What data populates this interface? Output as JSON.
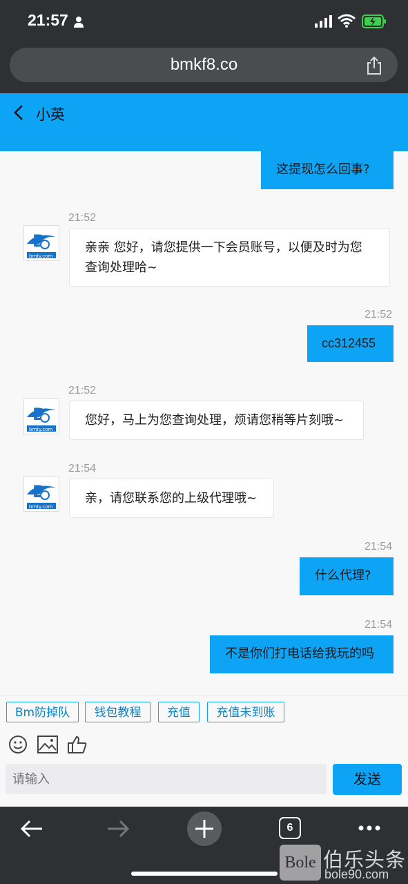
{
  "status": {
    "time": "21:57"
  },
  "browser": {
    "url": "bmkf8.co",
    "tab_count": "6"
  },
  "chat": {
    "title": "小英",
    "messages": [
      {
        "side": "out",
        "text": "这提现怎么回事?"
      },
      {
        "side": "in",
        "time": "21:52",
        "text1": "亲亲 您好，请您提供一下会员账号，以便及时为您",
        "text2": "查询处理哈~"
      },
      {
        "side": "out",
        "time": "21:52",
        "text": "cc312455"
      },
      {
        "side": "in",
        "time": "21:52",
        "text": "您好，马上为您查询处理，烦请您稍等片刻哦~"
      },
      {
        "side": "in",
        "time": "21:54",
        "text": "亲，请您联系您的上级代理哦~"
      },
      {
        "side": "out",
        "time": "21:54",
        "text": "什么代理?"
      },
      {
        "side": "out",
        "time": "21:54",
        "text": "不是你们打电话给我玩的吗"
      }
    ],
    "avatar_text": "bmty.com"
  },
  "quick_replies": [
    "Bm防掉队",
    "钱包教程",
    "充值",
    "充值未到账"
  ],
  "composer": {
    "placeholder": "请输入",
    "send_label": "发送"
  },
  "watermark": {
    "logo": "Bole",
    "name": "伯乐头条",
    "site": "bole90.com"
  },
  "colors": {
    "accent": "#0ea4f6",
    "chrome": "#2f3033"
  }
}
